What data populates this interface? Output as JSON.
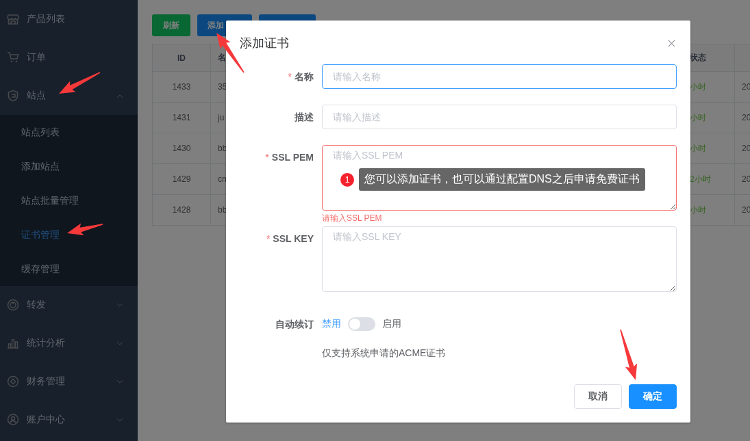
{
  "sidebar": {
    "items": [
      {
        "label": "产品列表"
      },
      {
        "label": "订单"
      },
      {
        "label": "站点",
        "expanded": true,
        "children": [
          {
            "label": "站点列表",
            "selected": false
          },
          {
            "label": "添加站点",
            "selected": false
          },
          {
            "label": "站点批量管理",
            "selected": false
          },
          {
            "label": "证书管理",
            "selected": true
          },
          {
            "label": "缓存管理",
            "selected": false
          }
        ]
      },
      {
        "label": "转发",
        "expanded": false
      },
      {
        "label": "统计分析",
        "expanded": false
      },
      {
        "label": "财务管理",
        "expanded": false
      },
      {
        "label": "账户中心",
        "expanded": false
      }
    ]
  },
  "toolbar": {
    "buttons": [
      {
        "label": "刷新",
        "kind": "success"
      },
      {
        "label": "添加",
        "kind": "primary"
      },
      {
        "kind": "primary"
      }
    ]
  },
  "table": {
    "columns": [
      "ID",
      "名",
      "状态"
    ],
    "rows": [
      [
        "1433",
        "35",
        "小时",
        "20"
      ],
      [
        "1431",
        "ju",
        "小时",
        "20"
      ],
      [
        "1430",
        "bb",
        "小时",
        "20"
      ],
      [
        "1429",
        "cn",
        "2小时",
        "20"
      ],
      [
        "1428",
        "bb",
        "小时",
        "20"
      ]
    ]
  },
  "dialog": {
    "title": "添加证书",
    "fields": [
      {
        "label": "名称",
        "marker": "*",
        "kind": "input",
        "placeholder": "请输入名称",
        "focused": true
      },
      {
        "label": "描述",
        "kind": "input",
        "placeholder": "请输入描述",
        "focused": false
      },
      {
        "label": "SSL PEM",
        "marker": "*",
        "kind": "textarea",
        "placeholder": "请输入SSL PEM",
        "focused": false,
        "error": "请输入SSL PEM"
      },
      {
        "label": "SSL KEY",
        "marker": "*",
        "kind": "textarea",
        "placeholder": "请输入SSL KEY",
        "focused": false
      }
    ],
    "auto_renew": {
      "label": "自动续订",
      "off_label": "禁用",
      "on_label": "启用",
      "on": false,
      "hint": "仅支持系统申请的ACME证书"
    },
    "tooltip": {
      "badge": "1",
      "text": "您可以添加证书，也可以通过配置DNS之后申请免费证书"
    },
    "buttons": [
      {
        "label": "取消",
        "kind": "default"
      },
      {
        "label": "确定",
        "kind": "primary"
      }
    ]
  }
}
